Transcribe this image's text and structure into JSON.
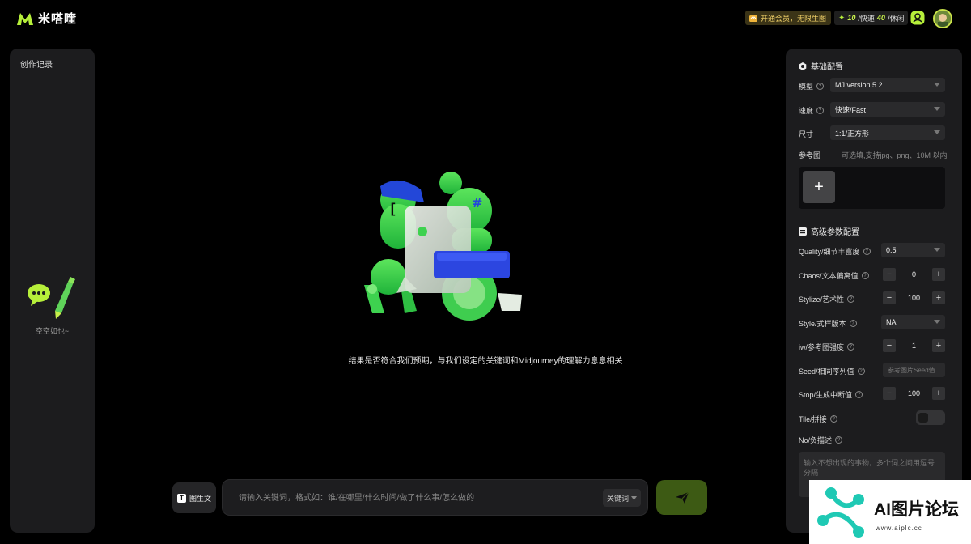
{
  "header": {
    "app_name": "米嗒喹",
    "vip_label": "开通会员，无限生图",
    "quota": {
      "fast_num": "10",
      "fast_label": "/快速",
      "relax_num": "40",
      "relax_label": "/休闲"
    }
  },
  "sidebar": {
    "title": "创作记录",
    "empty_text": "空空如也~"
  },
  "main": {
    "hint": "结果是否符合我们预期，与我们设定的关键词和Midjourney的理解力息息相关"
  },
  "prompt": {
    "image_to_text_label": "图生文",
    "placeholder": "请输入关键词，格式如：谁/在哪里/什么时间/做了什么事/怎么做的",
    "mode_label": "关键词"
  },
  "basic_config": {
    "title": "基础配置",
    "model_label": "模型",
    "model_value": "MJ version 5.2",
    "speed_label": "速度",
    "speed_value": "快速/Fast",
    "size_label": "尺寸",
    "size_value": "1:1/正方形",
    "ref_label": "参考图",
    "ref_hint": "可选填,支持jpg、png、10M 以内",
    "add_label": "+"
  },
  "advanced_config": {
    "title": "高级参数配置",
    "quality_label": "Quality/细节丰富度",
    "quality_value": "0.5",
    "chaos_label": "Chaos/文本偏离值",
    "chaos_value": "0",
    "stylize_label": "Stylize/艺术性",
    "stylize_value": "100",
    "style_label": "Style/式样版本",
    "style_value": "NA",
    "iw_label": "iw/参考图强度",
    "iw_value": "1",
    "seed_label": "Seed/相同序列值",
    "seed_placeholder": "参考图片Seed值",
    "stop_label": "Stop/生成中断值",
    "stop_value": "100",
    "tile_label": "Tile/拼接",
    "no_label": "No/负描述",
    "no_placeholder": "输入不想出现的事物，多个词之间用逗号分隔",
    "minus": "−",
    "plus": "+"
  },
  "watermark": {
    "text": "AI图片论坛",
    "url": "www.aiplc.cc"
  },
  "colors": {
    "accent": "#b6ef3a",
    "send_bg": "#3d5a14",
    "panel_bg": "#1c1c1e"
  }
}
